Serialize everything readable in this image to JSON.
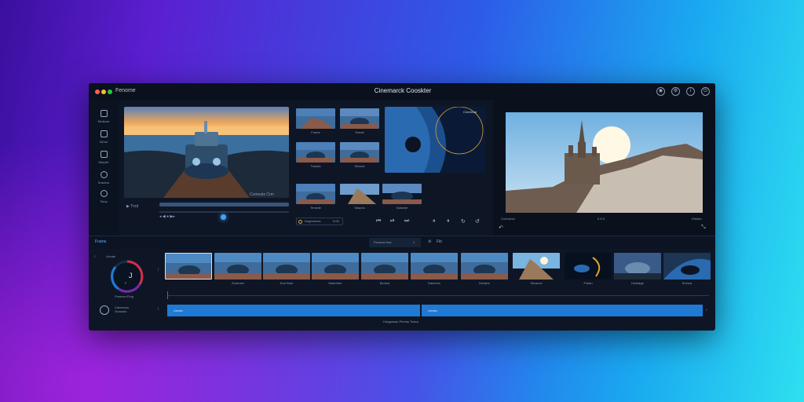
{
  "window": {
    "app_name": "Fenome",
    "title": "Cinemarck Cooskter",
    "title_icons": [
      "profile-icon",
      "settings-icon",
      "info-icon",
      "power-icon"
    ]
  },
  "sidebar": {
    "items": [
      {
        "label": "Mrdesar",
        "icon": "folder-icon"
      },
      {
        "label": "Kiinar",
        "icon": "document-icon"
      },
      {
        "label": "Merpile",
        "icon": "layers-icon"
      },
      {
        "label": "Sracess",
        "icon": "gear-icon"
      },
      {
        "label": "Teioy",
        "icon": "globe-icon"
      }
    ]
  },
  "source_monitor": {
    "play_label": "▶ Trod",
    "status": "Comeats   Crm",
    "transport": "◂ ◀ ● ▶▸"
  },
  "media_grid": {
    "captions": [
      "Frame",
      "Sracte",
      "Trsasts",
      "Seesxe",
      "Tensble",
      "Saspos",
      "Daiavke"
    ],
    "footer_label": "Dogremess",
    "footer_value": "0:00"
  },
  "editor_preview": {
    "label": "Cheetiont"
  },
  "program_monitor": {
    "left_caption": "Cortmicxs",
    "center_caption": "5 5 5",
    "right_caption": "Kfmdrs"
  },
  "transport_buttons": [
    "⏮",
    "⏯",
    "⏭",
    "⏸",
    "⏸",
    "↻",
    "↺"
  ],
  "toolbar2": {
    "section": "Frame",
    "tab_label": "Pinnesd frea",
    "tab_value": "1",
    "fx_label": "Fib"
  },
  "dial": {
    "label_top": "Livrate",
    "value": "J",
    "sub": "F",
    "caption": "Frenesn·Flug"
  },
  "filmstrip": {
    "captions": [
      "",
      "Sonenee",
      "Dorl Bme",
      "Manrebre",
      "Benlod",
      "Daireves",
      "Dedsbe",
      "Saranos",
      "Frslan",
      "Hestatge",
      "Srivsra",
      ""
    ]
  },
  "timeline": {
    "track_a_label": "Lieaes",
    "track_b_label": "Lieaes",
    "footer": "Hosgarsan Pereas Tosea",
    "panel_label": "Canesoon\nGuaauto"
  },
  "colors": {
    "accent": "#1f7ad6",
    "window_bg": "#0e1626",
    "dial_red": "#d5304a"
  }
}
